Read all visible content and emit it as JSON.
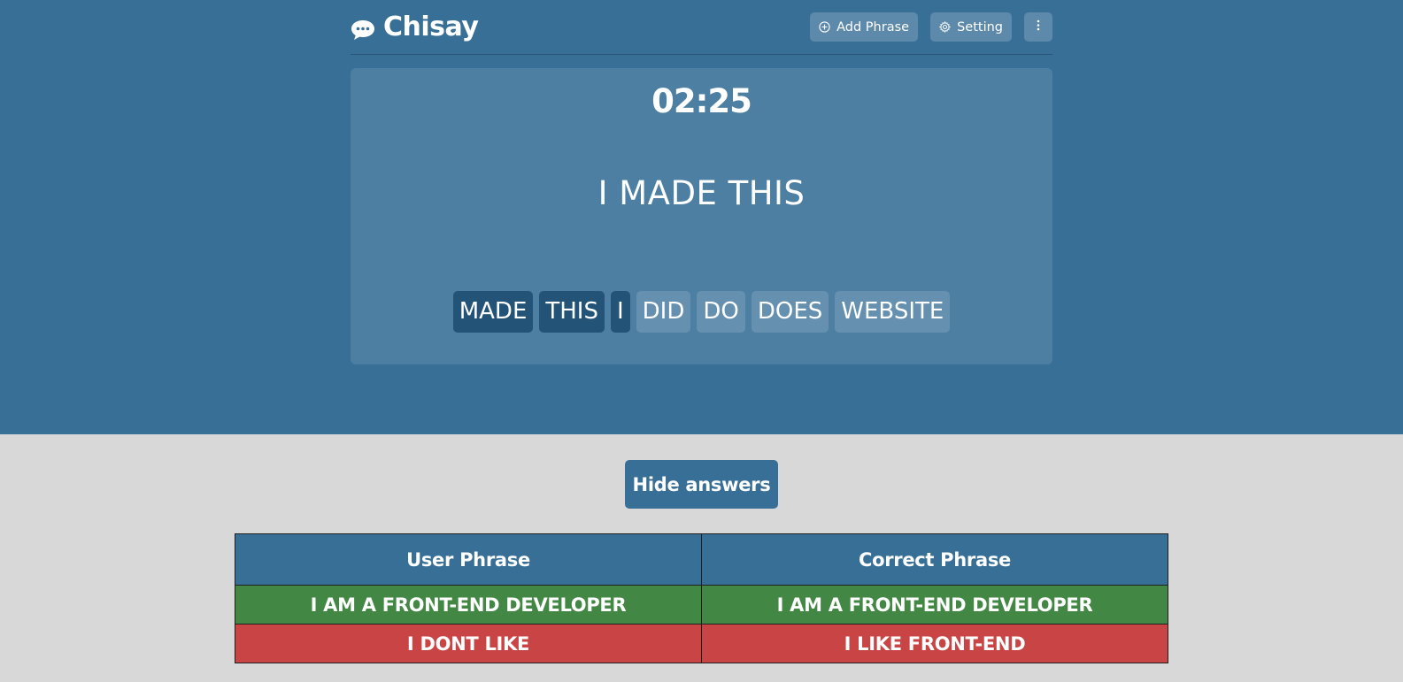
{
  "app": {
    "name": "Chisay",
    "logo_icon": "speech-bubble-icon"
  },
  "header": {
    "add_phrase_label": "Add Phrase",
    "add_phrase_icon": "plus-circle-icon",
    "setting_label": "Setting",
    "setting_icon": "gear-icon",
    "more_icon": "vertical-dots-icon"
  },
  "game": {
    "timer": "02:25",
    "phrase": "I MADE THIS",
    "words": [
      {
        "text": "MADE",
        "selected": true
      },
      {
        "text": "THIS",
        "selected": true
      },
      {
        "text": "I",
        "selected": true
      },
      {
        "text": "DID",
        "selected": false
      },
      {
        "text": "DO",
        "selected": false
      },
      {
        "text": "DOES",
        "selected": false
      },
      {
        "text": "WEBSITE",
        "selected": false
      }
    ]
  },
  "answers": {
    "toggle_label": "Hide answers",
    "columns": [
      "User Phrase",
      "Correct Phrase"
    ],
    "rows": [
      {
        "user": "I AM A FRONT-END DEVELOPER",
        "correct": "I AM A FRONT-END DEVELOPER",
        "status": "correct"
      },
      {
        "user": "I DONT LIKE",
        "correct": "I LIKE FRONT-END",
        "status": "incorrect"
      }
    ]
  },
  "colors": {
    "primary": "#386f96",
    "card": "#4d7fa2",
    "word_selected": "#245378",
    "word_unselected": "#6690b0",
    "background_bottom": "#d8d8d8",
    "correct": "#438745",
    "incorrect": "#c94545"
  }
}
